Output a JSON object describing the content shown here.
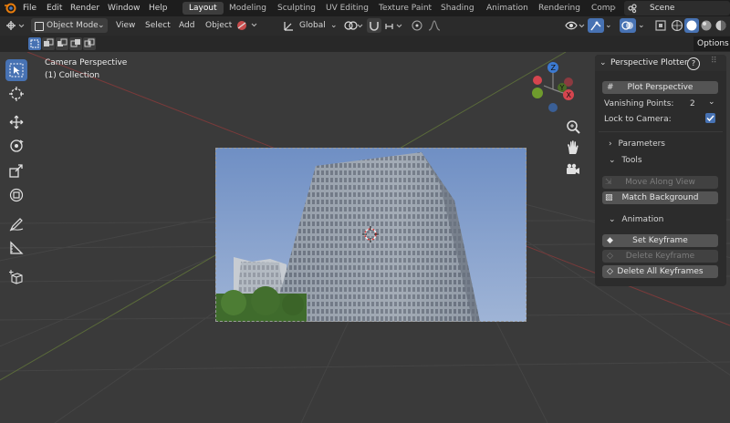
{
  "menubar": {
    "items": [
      "File",
      "Edit",
      "Render",
      "Window",
      "Help"
    ],
    "workspaces": [
      "Layout",
      "Modeling",
      "Sculpting",
      "UV Editing",
      "Texture Paint",
      "Shading",
      "Animation",
      "Rendering",
      "Compo"
    ],
    "active_workspace": "Layout",
    "scene_label": "Scene"
  },
  "header": {
    "mode": "Object Mode",
    "menus": [
      "View",
      "Select",
      "Add",
      "Object"
    ],
    "transform_orientation": "Global"
  },
  "subheader": {
    "options_label": "Options"
  },
  "viewport": {
    "view_name": "Camera Perspective",
    "collection": "(1) Collection",
    "gizmo_axes": {
      "x": "X",
      "y": "Y",
      "z": "Z"
    }
  },
  "panel": {
    "title": "Perspective Plotter",
    "plot_button": "Plot Perspective",
    "vanishing_label": "Vanishing Points:",
    "vanishing_value": "2",
    "lock_label": "Lock to Camera:",
    "lock_checked": true,
    "parameters_label": "Parameters",
    "tools_label": "Tools",
    "move_along_view": "Move Along View",
    "match_background": "Match Background",
    "animation_label": "Animation",
    "set_keyframe": "Set Keyframe",
    "delete_keyframe": "Delete Keyframe",
    "delete_all_keyframes": "Delete All Keyframes"
  },
  "colors": {
    "accent": "#4772b3",
    "x_axis": "#d5454e",
    "y_axis": "#6f9b2d",
    "z_axis": "#3c7ad1"
  }
}
